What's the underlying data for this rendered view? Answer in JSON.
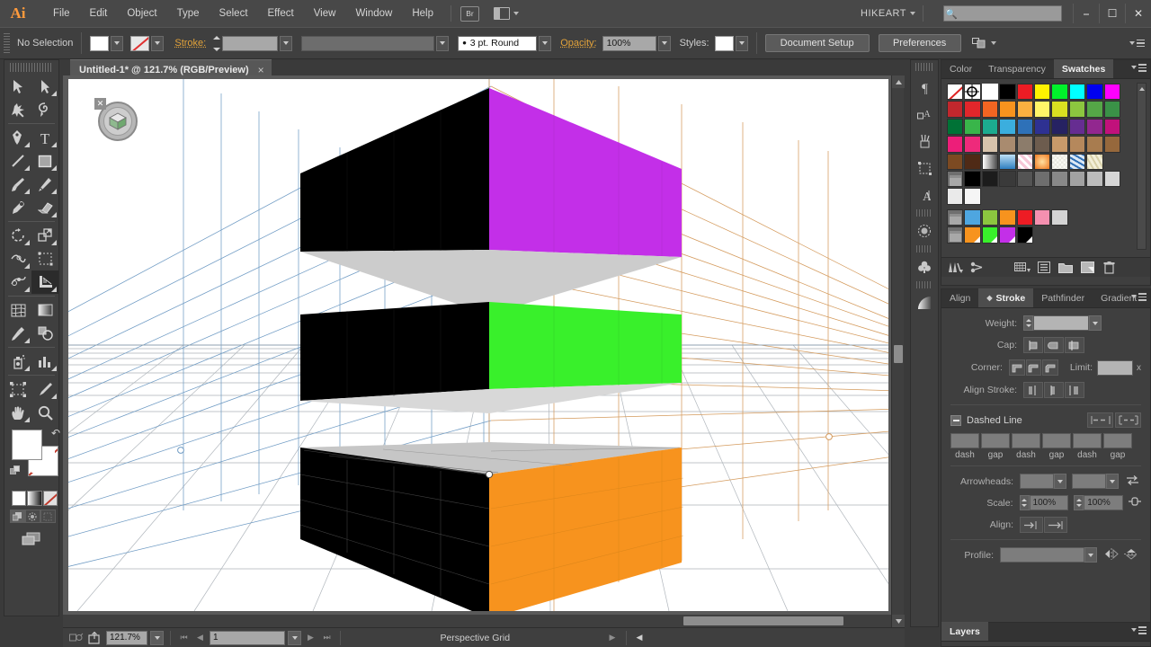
{
  "app": {
    "logo": "Ai",
    "workspace": "HIKEART",
    "bridge_label": "Br"
  },
  "menu": {
    "items": [
      "File",
      "Edit",
      "Object",
      "Type",
      "Select",
      "Effect",
      "View",
      "Window",
      "Help"
    ]
  },
  "window_controls": {
    "minimize": "—",
    "maximize": "❐",
    "close": "✕"
  },
  "search": {
    "value": "",
    "placeholder": "",
    "icon": "search-icon"
  },
  "control_bar": {
    "selection_status": "No Selection",
    "fill_color": "#ffffff",
    "stroke_label": "Stroke:",
    "stroke_value": "",
    "brush_definition": "3 pt. Round",
    "opacity_label": "Opacity:",
    "opacity_value": "100%",
    "style_label": "Styles:",
    "document_setup": "Document Setup",
    "preferences": "Preferences"
  },
  "document_tab": {
    "title": "Untitled-1* @ 121.7% (RGB/Preview)",
    "close": "×"
  },
  "tools": [
    {
      "name": "selection-tool",
      "has_flyout": false
    },
    {
      "name": "direct-selection-tool",
      "has_flyout": true
    },
    {
      "name": "magic-wand-tool",
      "has_flyout": false
    },
    {
      "name": "lasso-tool",
      "has_flyout": false
    },
    {
      "name": "pen-tool",
      "has_flyout": true
    },
    {
      "name": "type-tool",
      "has_flyout": true
    },
    {
      "name": "line-segment-tool",
      "has_flyout": true
    },
    {
      "name": "rectangle-tool",
      "has_flyout": true
    },
    {
      "name": "paintbrush-tool",
      "has_flyout": true
    },
    {
      "name": "pencil-tool",
      "has_flyout": true
    },
    {
      "name": "blob-brush-tool",
      "has_flyout": false
    },
    {
      "name": "eraser-tool",
      "has_flyout": true
    },
    {
      "name": "rotate-tool",
      "has_flyout": true
    },
    {
      "name": "scale-tool",
      "has_flyout": true
    },
    {
      "name": "width-tool",
      "has_flyout": true
    },
    {
      "name": "free-transform-tool",
      "has_flyout": false
    },
    {
      "name": "shape-builder-tool",
      "has_flyout": true
    },
    {
      "name": "perspective-grid-tool",
      "has_flyout": true,
      "active": true
    },
    {
      "name": "mesh-tool",
      "has_flyout": false
    },
    {
      "name": "gradient-tool",
      "has_flyout": false
    },
    {
      "name": "eyedropper-tool",
      "has_flyout": true
    },
    {
      "name": "blend-tool",
      "has_flyout": false
    },
    {
      "name": "symbol-sprayer-tool",
      "has_flyout": true
    },
    {
      "name": "column-graph-tool",
      "has_flyout": true
    },
    {
      "name": "artboard-tool",
      "has_flyout": false
    },
    {
      "name": "slice-tool",
      "has_flyout": true
    },
    {
      "name": "hand-tool",
      "has_flyout": true
    },
    {
      "name": "zoom-tool",
      "has_flyout": false
    }
  ],
  "swatches_panel": {
    "tabs": [
      {
        "label": "Color",
        "active": false
      },
      {
        "label": "Transparency",
        "active": false
      },
      {
        "label": "Swatches",
        "active": true
      }
    ],
    "rows": [
      [
        "none",
        "registration",
        "#ffffff",
        "#000000",
        "#ed1c24",
        "#fff200",
        "#00f12b",
        "#00ffff",
        "#0000f0",
        "#ff00ff"
      ],
      [
        "#c1272d",
        "#e1262b",
        "#f26522",
        "#f7931e",
        "#fbb040",
        "#fff568",
        "#d9e021",
        "#8cc63f",
        "#55a647",
        "#3a9247"
      ],
      [
        "#007236",
        "#39b54a",
        "#1cab8f",
        "#3baede",
        "#2e71b8",
        "#2e3192",
        "#262262",
        "#662d91",
        "#92278f",
        "#c1117b"
      ],
      [
        "#ed1e79",
        "#ee2a7b",
        "#d7c3ab",
        "#a98b6f",
        "#8c7c6b",
        "#6d5c4e",
        "#c89a6a",
        "#b5885c",
        "#a87c4f",
        "#96683c"
      ],
      [
        "#7c4a22",
        "#4f2a16",
        "gradient-white-black",
        "gradient-blue",
        "pattern-pink",
        "gradient-orange",
        "pattern-dots",
        "pattern-blue-floral",
        "pattern-beige",
        "empty"
      ],
      [
        "folder",
        "#000000",
        "#1c1c1c",
        "#3a3a3a",
        "#545454",
        "#6e6e6e",
        "#888888",
        "#a2a2a2",
        "#bcbcbc",
        "#d6d6d6"
      ],
      [
        "#eaeaea",
        "#f5f5f5",
        "empty",
        "empty",
        "empty",
        "empty",
        "empty",
        "empty",
        "empty",
        "empty"
      ],
      [
        "folder",
        "#4ea6e0",
        "#8cc63f",
        "#f7931e",
        "#ed1c24",
        "#f590b0",
        "#d4d4d4",
        "empty",
        "empty",
        "empty"
      ],
      [
        "folder",
        "#f7931e-c",
        "#39f02b-c",
        "#c32fe8-c",
        "#000000-c",
        "empty",
        "empty",
        "empty",
        "empty",
        "empty"
      ]
    ],
    "footer_icons": [
      "swatch-libraries-icon",
      "link-color-harmony-icon",
      "new-color-group-icon",
      "swatch-options-icon",
      "new-swatch-icon",
      "delete-swatch-icon"
    ]
  },
  "stroke_panel": {
    "tabs": [
      {
        "label": "Align",
        "active": false
      },
      {
        "label": "Stroke",
        "active": true
      },
      {
        "label": "Pathfinder",
        "active": false
      },
      {
        "label": "Gradient",
        "active": false
      }
    ],
    "weight_label": "Weight:",
    "weight_value": "",
    "cap_label": "Cap:",
    "corner_label": "Corner:",
    "limit_label": "Limit:",
    "limit_value": "",
    "limit_unit": "x",
    "align_stroke_label": "Align Stroke:",
    "dashed_line_label": "Dashed Line",
    "dash_fields": [
      {
        "value": "",
        "caption": "dash"
      },
      {
        "value": "",
        "caption": "gap"
      },
      {
        "value": "",
        "caption": "dash"
      },
      {
        "value": "",
        "caption": "gap"
      },
      {
        "value": "",
        "caption": "dash"
      },
      {
        "value": "",
        "caption": "gap"
      }
    ],
    "arrowheads_label": "Arrowheads:",
    "arrowhead_start": "",
    "arrowhead_end": "",
    "scale_label": "Scale:",
    "scale_start": "100%",
    "scale_end": "100%",
    "align_label": "Align:",
    "profile_label": "Profile:",
    "profile_value": ""
  },
  "layers_panel": {
    "tab_label": "Layers"
  },
  "icon_strip": [
    "paragraph-icon",
    "character-styles-icon",
    "brushes-icon",
    "symbols-icon",
    "type-icon",
    "transparency-icon",
    "symbol-library-icon",
    "gradient-icon"
  ],
  "status_bar": {
    "zoom_value": "121.7%",
    "page_value": "1",
    "status_text": "Perspective Grid",
    "nav_first": "⏮",
    "nav_prev": "◀",
    "nav_next": "▶",
    "nav_last": "⏭"
  },
  "artwork": {
    "description": "Three stacked perspective boxes on a two-point perspective grid",
    "perspective_widget": "perspective-grid-widget",
    "grid_colors": {
      "left_plane": "#7a9fc4",
      "right_plane": "#d49a5c",
      "horizontal_plane": "#9aa0a6",
      "horizon_line": "#7e8e9e"
    },
    "boxes": [
      {
        "name": "top-box",
        "left_face": "#000000",
        "right_face": "#c32fe8",
        "bottom_face": "#cccccc"
      },
      {
        "name": "middle-box",
        "left_face": "#000000",
        "right_face": "#39f02b",
        "bottom_face": "#d5d5d5"
      },
      {
        "name": "bottom-box",
        "left_face": "#000000",
        "right_face": "#f7931e",
        "top_face": "#c6c6c6"
      }
    ]
  }
}
